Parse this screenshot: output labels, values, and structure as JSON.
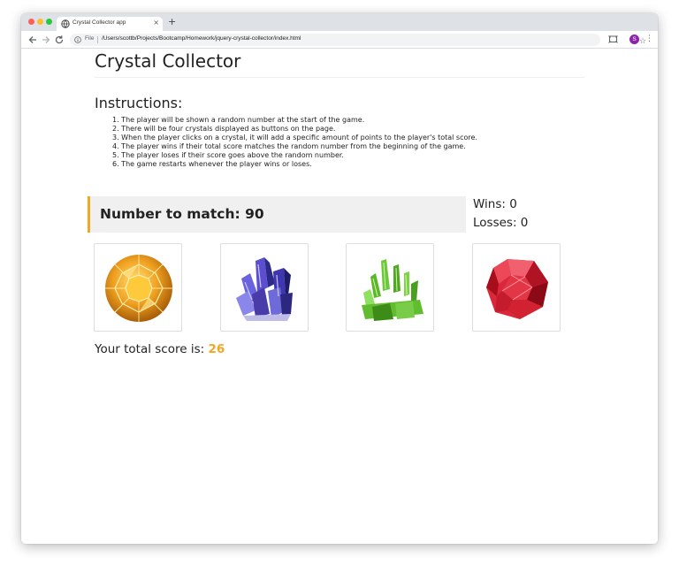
{
  "browser": {
    "tab_title": "Crystal Collector app",
    "tab_close": "×",
    "new_tab": "+",
    "address_scheme_label": "File",
    "address_url": "/Users/scottb/Projects/Bootcamp/Homework/jquery-crystal-collector/index.html",
    "profile_initial": "S",
    "star_glyph": "☆",
    "menu_glyph": "⋮",
    "icons": {
      "back": "back-arrow-icon",
      "forward": "forward-arrow-icon",
      "reload": "reload-icon",
      "info": "info-icon",
      "bookmark": "star-icon",
      "cast": "cast-icon",
      "menu": "kebab-menu-icon"
    }
  },
  "page": {
    "title": "Crystal Collector",
    "instructions_heading": "Instructions:",
    "instructions": [
      "1. The player will be shown a random number at the start of the game.",
      "2. There will be four crystals displayed as buttons on the page.",
      "3. When the player clicks on a crystal, it will add a specific amount of points to the player's total score.",
      "4. The player wins if their total score matches the random number from the beginning of the game.",
      "5. The player loses if their score goes above the random number.",
      "6. The game restarts whenever the player wins or loses."
    ],
    "match_label": "Number to match: 90",
    "wins_label": "Wins: 0",
    "losses_label": "Losses: 0",
    "score_label": "Your total score is: ",
    "score_value": "26",
    "crystals": [
      {
        "name": "yellow-diamond-crystal",
        "color": "#f0a020"
      },
      {
        "name": "blue-crystal-cluster",
        "color": "#4a3ca8"
      },
      {
        "name": "green-crystal-cluster",
        "color": "#5cb82a"
      },
      {
        "name": "red-gem-crystal",
        "color": "#d8283a"
      }
    ],
    "accent_color": "#f5a623"
  }
}
